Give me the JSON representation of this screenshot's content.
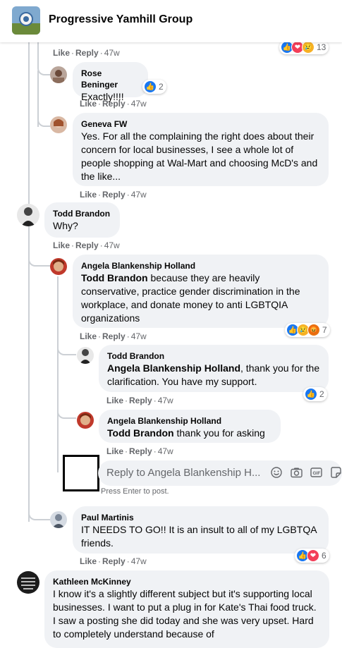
{
  "group": {
    "name": "Progressive Yamhill Group"
  },
  "actions": {
    "like": "Like",
    "reply": "Reply"
  },
  "colors": {
    "like": "#1877f2",
    "love": "#f33e58",
    "sad": "#f7b125",
    "angry": "#e9710f",
    "bubble": "#f0f2f5"
  },
  "top_comment": {
    "time": "47w",
    "reaction_count": "13",
    "reactions": [
      "like-icon",
      "love-icon",
      "sad-icon"
    ]
  },
  "comments": [
    {
      "author": "Rose Beninger",
      "text": "Exactly!!!!",
      "time": "47w",
      "reaction_count": "2",
      "reactions": [
        "like-icon"
      ]
    },
    {
      "author": "Geneva FW",
      "text": "Yes. For all the complaining the right does about their concern for local businesses, I see a whole lot of people shopping at Wal-Mart and choosing McD's and the like...",
      "time": "47w"
    },
    {
      "author": "Todd Brandon",
      "text": "Why?",
      "time": "47w"
    },
    {
      "author": "Angela Blankenship Holland",
      "mention": "Todd Brandon",
      "text": " because they are heavily conservative, practice gender discrimination in the workplace, and donate money to anti LGBTQIA organizations",
      "time": "47w",
      "reaction_count": "7",
      "reactions": [
        "like-icon",
        "sad-icon",
        "angry-icon"
      ]
    },
    {
      "author": "Todd Brandon",
      "mention": "Angela Blankenship Holland",
      "text": ", thank you for the clarification. You have my support.",
      "time": "47w",
      "reaction_count": "2",
      "reactions": [
        "like-icon"
      ]
    },
    {
      "author": "Angela Blankenship Holland",
      "mention": "Todd Brandon",
      "text": " thank you for asking",
      "time": "47w"
    },
    {
      "author": "Paul Martinis",
      "text": "IT NEEDS TO GO!! It is an insult to all of my LGBTQA friends.",
      "time": "47w",
      "reaction_count": "6",
      "reactions": [
        "like-icon",
        "love-icon"
      ]
    },
    {
      "author": "Kathleen McKinney",
      "text": "I know it's a slightly different subject but it's supporting local businesses. I want to put a plug in for Kate's Thai food truck. I saw a posting she did today and she was very upset. Hard to completely understand because of"
    }
  ],
  "reply_box": {
    "placeholder": "Reply to Angela Blankenship H...",
    "hint": "Press Enter to post."
  }
}
